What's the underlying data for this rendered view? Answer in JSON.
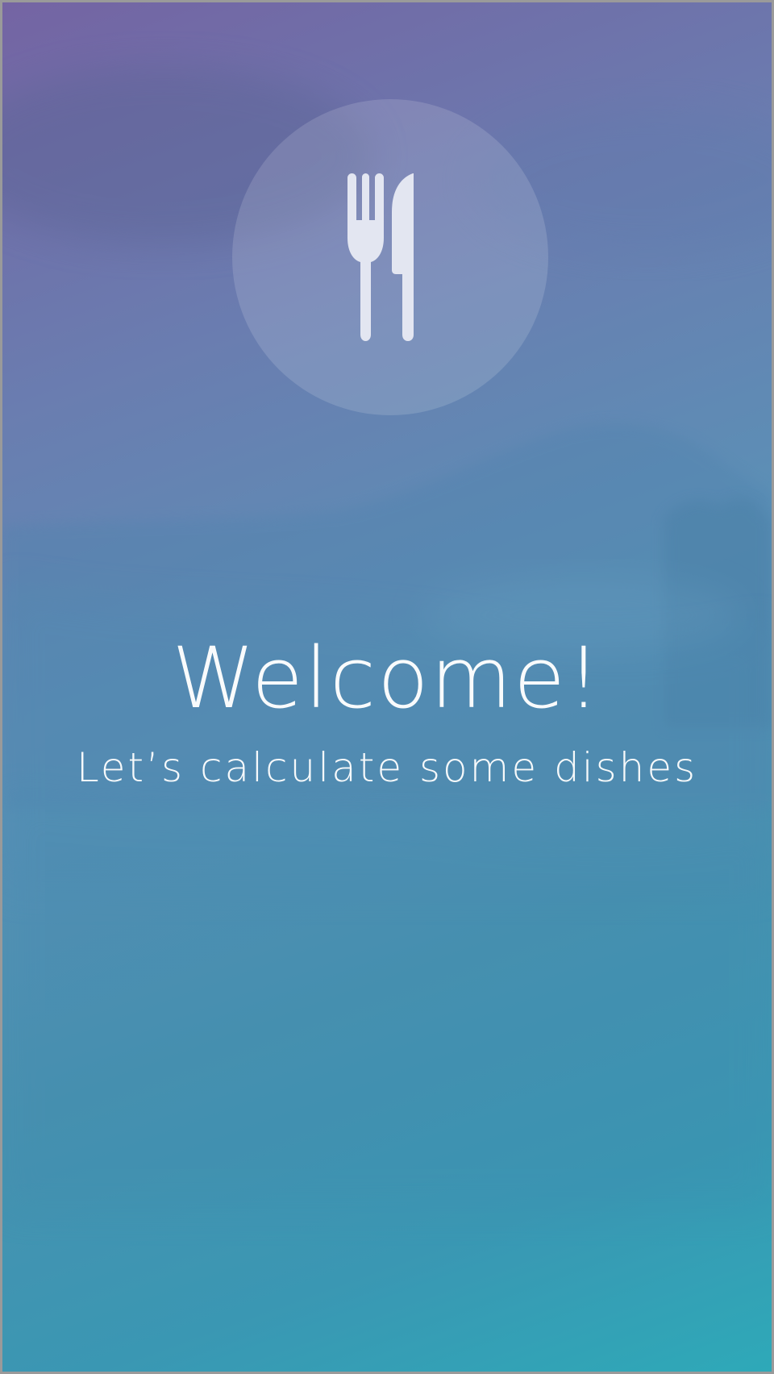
{
  "logo": {
    "icon": "fork-knife-icon"
  },
  "welcome": {
    "title": "Welcome!",
    "subtitle": "Let’s calculate some dishes"
  },
  "colors": {
    "gradient_top": "#7464a3",
    "gradient_bottom": "#2ea9b8",
    "text": "#ffffff",
    "icon": "#e3e6f1"
  }
}
